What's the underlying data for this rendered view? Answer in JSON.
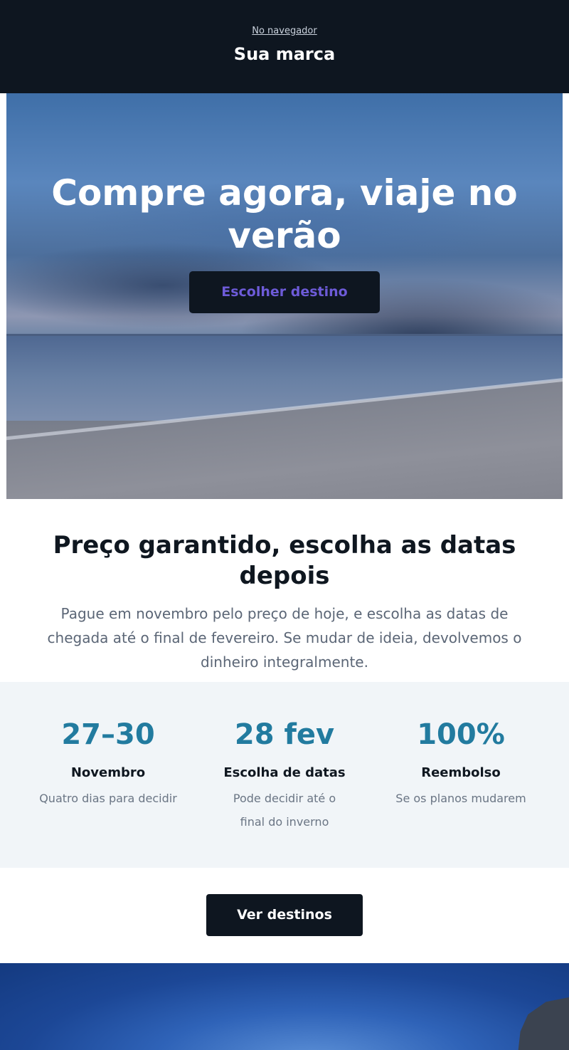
{
  "header": {
    "browser_link": "No navegador",
    "brand": "Sua marca"
  },
  "hero": {
    "title": "Compre agora, viaje no verão",
    "cta": "Escolher destino"
  },
  "intro": {
    "heading": "Preço garantido, escolha as datas depois",
    "body": "Pague em novembro pelo preço de hoje, e escolha as datas de chegada até o final de fevereiro. Se mudar de ideia, devolvemos o dinheiro integralmente."
  },
  "stats": [
    {
      "value": "27–30",
      "label": "Novembro",
      "desc": "Quatro dias para decidir"
    },
    {
      "value": "28 fev",
      "label": "Escolha de datas",
      "desc": "Pode decidir até o final do inverno"
    },
    {
      "value": "100%",
      "label": "Reembolso",
      "desc": "Se os planos mudarem"
    }
  ],
  "cta2": "Ver destinos",
  "colors": {
    "header_bg": "#0e1620",
    "accent_teal": "#227b9f",
    "hero_cta_text": "#6d5bd8",
    "stats_bg": "#f1f5f8"
  }
}
